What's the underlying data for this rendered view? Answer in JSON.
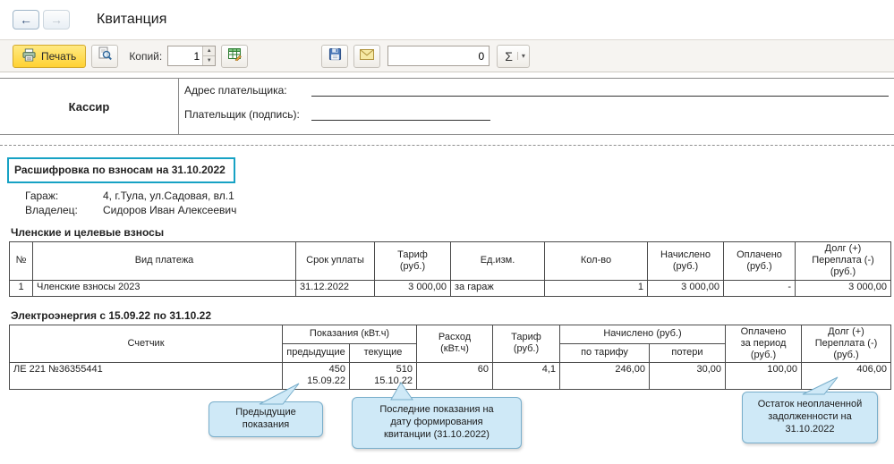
{
  "window": {
    "title": "Квитанция"
  },
  "icons": {
    "back": "←",
    "forward": "→",
    "spin_up": "▲",
    "spin_down": "▼",
    "sigma_caret": "▾"
  },
  "toolbar": {
    "print_label": "Печать",
    "copies_label": "Копий:",
    "copies_value": "1",
    "amount_value": "0",
    "sigma_label": "Σ"
  },
  "slip": {
    "cashier": "Кассир",
    "address_label": "Адрес плательщика:",
    "signature_label": "Плательщик (подпись):"
  },
  "details": {
    "title": "Расшифровка по взносам на 31.10.2022",
    "garage_label": "Гараж:",
    "garage_value": "4, г.Тула, ул.Садовая, вл.1",
    "owner_label": "Владелец:",
    "owner_value": "Сидоров Иван Алексеевич"
  },
  "fees_table": {
    "title": "Членские и целевые взносы",
    "headers": [
      "№",
      "Вид платежа",
      "Срок уплаты",
      "Тариф\n(руб.)",
      "Ед.изм.",
      "Кол-во",
      "Начислено\n(руб.)",
      "Оплачено\n(руб.)",
      "Долг (+)\nПереплата (-)\n(руб.)"
    ],
    "row": [
      "1",
      "Членские взносы 2023",
      "31.12.2022",
      "3 000,00",
      "за гараж",
      "1",
      "3 000,00",
      "-",
      "3 000,00"
    ]
  },
  "energy_table": {
    "title": "Электроэнергия с 15.09.22 по 31.10.22",
    "h_meter": "Счетчик",
    "h_readings": "Показания (кВт.ч)",
    "h_prev": "предыдущие",
    "h_curr": "текущие",
    "h_consumption": "Расход\n(кВт.ч)",
    "h_tariff": "Тариф\n(руб.)",
    "h_accrued": "Начислено (руб.)",
    "h_by_tariff": "по тарифу",
    "h_losses": "потери",
    "h_paid": "Оплачено\nза период\n(руб.)",
    "h_debt": "Долг (+)\nПереплата (-)\n(руб.)",
    "row": [
      "ЛЕ 221 №36355441",
      "450\n15.09.22",
      "510\n15.10.22",
      "60",
      "4,1",
      "246,00",
      "30,00",
      "100,00",
      "406,00"
    ]
  },
  "callouts": [
    {
      "text": "Предыдущие\nпоказания"
    },
    {
      "text": "Последние показания на\nдату формирования\nквитанции (31.10.2022)"
    },
    {
      "text": "Остаток неоплаченной\nзадолженности на\n31.10.2022"
    }
  ],
  "colors": {
    "print_button": "#ffd233",
    "callout_fill": "#cfe9f7",
    "callout_border": "#78aecb",
    "highlight_border": "#17a2c4"
  }
}
